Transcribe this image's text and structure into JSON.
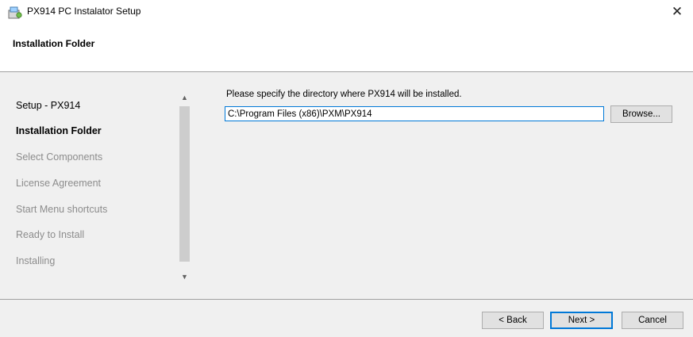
{
  "window": {
    "title": "PX914 PC Instalator Setup",
    "close_glyph": "✕",
    "icon": "installer-icon"
  },
  "header": {
    "title": "Installation Folder"
  },
  "sidebar": {
    "items": [
      {
        "label": "Setup - PX914",
        "state": "done"
      },
      {
        "label": "Installation Folder",
        "state": "current"
      },
      {
        "label": "Select Components",
        "state": "todo"
      },
      {
        "label": "License Agreement",
        "state": "todo"
      },
      {
        "label": "Start Menu shortcuts",
        "state": "todo"
      },
      {
        "label": "Ready to Install",
        "state": "todo"
      },
      {
        "label": "Installing",
        "state": "todo"
      }
    ],
    "scroll_up_glyph": "▲",
    "scroll_down_glyph": "▼"
  },
  "main": {
    "prompt": "Please specify the directory where PX914 will be installed.",
    "path_value": "C:\\Program Files (x86)\\PXM\\PX914",
    "browse_label": "Browse..."
  },
  "footer": {
    "back_label": "< Back",
    "next_label": "Next >",
    "cancel_label": "Cancel"
  },
  "colors": {
    "accent": "#0078d7",
    "inactive_text": "#8c8c8c"
  }
}
